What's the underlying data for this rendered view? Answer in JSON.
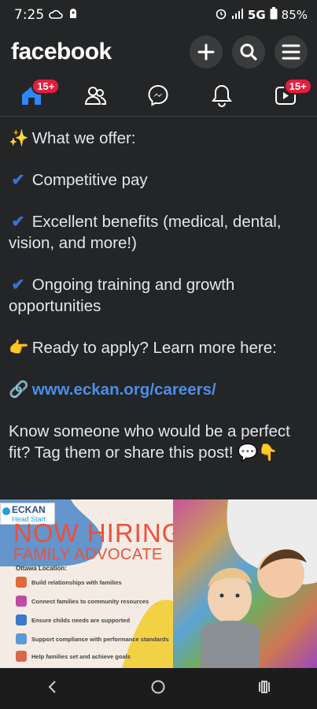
{
  "status": {
    "time": "7:25",
    "network": "5G",
    "battery": "85%"
  },
  "header": {
    "logo": "facebook"
  },
  "nav": {
    "home_badge": "15+",
    "video_badge": "15+"
  },
  "post": {
    "offer_heading": "What we offer:",
    "item1": "Competitive pay",
    "item2": "Excellent benefits (medical, dental, vision, and more!)",
    "item3": "Ongoing training and growth opportunities",
    "apply": "Ready to apply? Learn more here:",
    "link": "www.eckan.org/careers/",
    "share": "Know someone who would be a perfect fit? Tag them or share this post!"
  },
  "image": {
    "logo_line1": "ECKAN",
    "logo_line2": "Head Start",
    "hiring": "NOW HIRING",
    "position": "FAMILY ADVOCATE",
    "location": "Ottawa Location:",
    "duties": [
      "Build relationships with families",
      "Connect families to community resources",
      "Ensure childs needs are supported",
      "Support compliance with performance standards",
      "Help families set and achieve goals"
    ]
  },
  "icons": {
    "sparkle": "sparkles-icon",
    "check": "check-icon",
    "point": "pointing-icon",
    "link": "link-icon"
  }
}
